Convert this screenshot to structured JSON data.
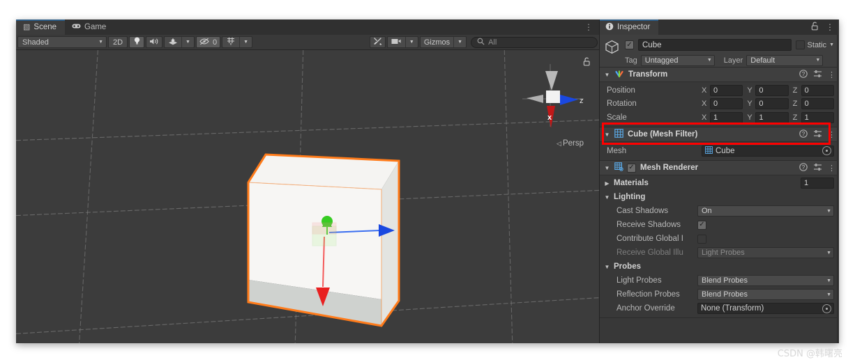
{
  "scene_panel": {
    "tabs": [
      {
        "label": "Scene",
        "icon": "grid-icon",
        "active": true
      },
      {
        "label": "Game",
        "icon": "gamepad-icon",
        "active": false
      }
    ],
    "overflow_menu": "⋮",
    "toolbar": {
      "draw_mode": "Shaded",
      "mode_2d": "2D",
      "lighting_icon": "lightbulb-icon",
      "audio_icon": "speaker-icon",
      "fx_icon": "effects-icon",
      "hidden_objects_count": "0",
      "hidden_objects_icon": "eye-off-icon",
      "grid_icon": "grid-visibility-icon",
      "tools_icon": "wrench-screwdriver-icon",
      "camera_icon": "camera-icon",
      "gizmos_label": "Gizmos",
      "search_placeholder": "All",
      "search_value": "",
      "search_icon": "search-icon"
    },
    "viewport": {
      "projection_label": "Persp",
      "axis_labels": {
        "x": "x",
        "z": "z"
      },
      "lock_icon": "lock-open-icon",
      "selected_object_outline": "#ff7b1a",
      "background": "#3c3c3c",
      "gizmo_axis_colors": {
        "x": "#e02020",
        "y": "#2fd01e",
        "z": "#1a48e0"
      }
    }
  },
  "inspector": {
    "tab_label": "Inspector",
    "tab_icon": "info-icon",
    "lock_icon": "lock-open-icon",
    "menu_icon": "⋮",
    "object": {
      "icon": "cube-icon",
      "enabled": true,
      "name": "Cube",
      "static_label": "Static",
      "static_checked": false,
      "tag_label": "Tag",
      "tag_value": "Untagged",
      "layer_label": "Layer",
      "layer_value": "Default"
    },
    "components": [
      {
        "id": "transform",
        "title": "Transform",
        "icon": "transform-axes-icon",
        "expanded": true,
        "has_checkbox": false,
        "rows": [
          {
            "label": "Position",
            "x": "0",
            "y": "0",
            "z": "0"
          },
          {
            "label": "Rotation",
            "x": "0",
            "y": "0",
            "z": "0"
          },
          {
            "label": "Scale",
            "x": "1",
            "y": "1",
            "z": "1",
            "highlighted": true
          }
        ]
      },
      {
        "id": "mesh-filter",
        "title": "Cube (Mesh Filter)",
        "icon": "mesh-filter-icon",
        "expanded": true,
        "has_checkbox": false,
        "mesh_label": "Mesh",
        "mesh_value": "Cube",
        "mesh_value_icon": "mesh-icon"
      },
      {
        "id": "mesh-renderer",
        "title": "Mesh Renderer",
        "icon": "mesh-renderer-icon",
        "expanded": true,
        "has_checkbox": true,
        "checked": true,
        "materials": {
          "label": "Materials",
          "count": "1"
        },
        "lighting": {
          "title": "Lighting",
          "cast_shadows_label": "Cast Shadows",
          "cast_shadows_value": "On",
          "receive_shadows_label": "Receive Shadows",
          "receive_shadows_checked": true,
          "contribute_gi_label": "Contribute Global I",
          "contribute_gi_checked": false,
          "receive_gi_label": "Receive Global Illu",
          "receive_gi_value": "Light Probes"
        },
        "probes": {
          "title": "Probes",
          "light_probes_label": "Light Probes",
          "light_probes_value": "Blend Probes",
          "reflection_probes_label": "Reflection Probes",
          "reflection_probes_value": "Blend Probes",
          "anchor_override_label": "Anchor Override",
          "anchor_override_value": "None (Transform)"
        }
      }
    ],
    "help_icon": "help-icon",
    "preset_icon": "preset-icon",
    "kebab_icon": "⋮"
  },
  "annotation": {
    "color": "#ff0000",
    "target": "Scale row"
  },
  "watermark": "CSDN @韩曙亮"
}
